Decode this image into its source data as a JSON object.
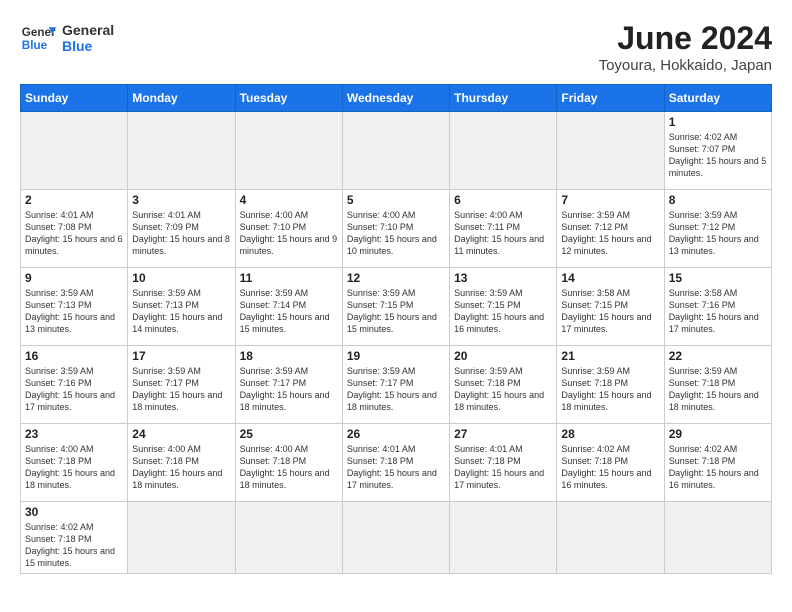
{
  "header": {
    "logo_general": "General",
    "logo_blue": "Blue",
    "title": "June 2024",
    "subtitle": "Toyoura, Hokkaido, Japan"
  },
  "days_of_week": [
    "Sunday",
    "Monday",
    "Tuesday",
    "Wednesday",
    "Thursday",
    "Friday",
    "Saturday"
  ],
  "weeks": [
    [
      {
        "day": "",
        "info": ""
      },
      {
        "day": "",
        "info": ""
      },
      {
        "day": "",
        "info": ""
      },
      {
        "day": "",
        "info": ""
      },
      {
        "day": "",
        "info": ""
      },
      {
        "day": "",
        "info": ""
      },
      {
        "day": "1",
        "info": "Sunrise: 4:02 AM\nSunset: 7:07 PM\nDaylight: 15 hours and 5 minutes."
      }
    ],
    [
      {
        "day": "2",
        "info": "Sunrise: 4:01 AM\nSunset: 7:08 PM\nDaylight: 15 hours and 6 minutes."
      },
      {
        "day": "3",
        "info": "Sunrise: 4:01 AM\nSunset: 7:09 PM\nDaylight: 15 hours and 8 minutes."
      },
      {
        "day": "4",
        "info": "Sunrise: 4:00 AM\nSunset: 7:10 PM\nDaylight: 15 hours and 9 minutes."
      },
      {
        "day": "5",
        "info": "Sunrise: 4:00 AM\nSunset: 7:10 PM\nDaylight: 15 hours and 10 minutes."
      },
      {
        "day": "6",
        "info": "Sunrise: 4:00 AM\nSunset: 7:11 PM\nDaylight: 15 hours and 11 minutes."
      },
      {
        "day": "7",
        "info": "Sunrise: 3:59 AM\nSunset: 7:12 PM\nDaylight: 15 hours and 12 minutes."
      },
      {
        "day": "8",
        "info": "Sunrise: 3:59 AM\nSunset: 7:12 PM\nDaylight: 15 hours and 13 minutes."
      }
    ],
    [
      {
        "day": "9",
        "info": "Sunrise: 3:59 AM\nSunset: 7:13 PM\nDaylight: 15 hours and 13 minutes."
      },
      {
        "day": "10",
        "info": "Sunrise: 3:59 AM\nSunset: 7:13 PM\nDaylight: 15 hours and 14 minutes."
      },
      {
        "day": "11",
        "info": "Sunrise: 3:59 AM\nSunset: 7:14 PM\nDaylight: 15 hours and 15 minutes."
      },
      {
        "day": "12",
        "info": "Sunrise: 3:59 AM\nSunset: 7:15 PM\nDaylight: 15 hours and 15 minutes."
      },
      {
        "day": "13",
        "info": "Sunrise: 3:59 AM\nSunset: 7:15 PM\nDaylight: 15 hours and 16 minutes."
      },
      {
        "day": "14",
        "info": "Sunrise: 3:58 AM\nSunset: 7:15 PM\nDaylight: 15 hours and 17 minutes."
      },
      {
        "day": "15",
        "info": "Sunrise: 3:58 AM\nSunset: 7:16 PM\nDaylight: 15 hours and 17 minutes."
      }
    ],
    [
      {
        "day": "16",
        "info": "Sunrise: 3:59 AM\nSunset: 7:16 PM\nDaylight: 15 hours and 17 minutes."
      },
      {
        "day": "17",
        "info": "Sunrise: 3:59 AM\nSunset: 7:17 PM\nDaylight: 15 hours and 18 minutes."
      },
      {
        "day": "18",
        "info": "Sunrise: 3:59 AM\nSunset: 7:17 PM\nDaylight: 15 hours and 18 minutes."
      },
      {
        "day": "19",
        "info": "Sunrise: 3:59 AM\nSunset: 7:17 PM\nDaylight: 15 hours and 18 minutes."
      },
      {
        "day": "20",
        "info": "Sunrise: 3:59 AM\nSunset: 7:18 PM\nDaylight: 15 hours and 18 minutes."
      },
      {
        "day": "21",
        "info": "Sunrise: 3:59 AM\nSunset: 7:18 PM\nDaylight: 15 hours and 18 minutes."
      },
      {
        "day": "22",
        "info": "Sunrise: 3:59 AM\nSunset: 7:18 PM\nDaylight: 15 hours and 18 minutes."
      }
    ],
    [
      {
        "day": "23",
        "info": "Sunrise: 4:00 AM\nSunset: 7:18 PM\nDaylight: 15 hours and 18 minutes."
      },
      {
        "day": "24",
        "info": "Sunrise: 4:00 AM\nSunset: 7:18 PM\nDaylight: 15 hours and 18 minutes."
      },
      {
        "day": "25",
        "info": "Sunrise: 4:00 AM\nSunset: 7:18 PM\nDaylight: 15 hours and 18 minutes."
      },
      {
        "day": "26",
        "info": "Sunrise: 4:01 AM\nSunset: 7:18 PM\nDaylight: 15 hours and 17 minutes."
      },
      {
        "day": "27",
        "info": "Sunrise: 4:01 AM\nSunset: 7:18 PM\nDaylight: 15 hours and 17 minutes."
      },
      {
        "day": "28",
        "info": "Sunrise: 4:02 AM\nSunset: 7:18 PM\nDaylight: 15 hours and 16 minutes."
      },
      {
        "day": "29",
        "info": "Sunrise: 4:02 AM\nSunset: 7:18 PM\nDaylight: 15 hours and 16 minutes."
      }
    ],
    [
      {
        "day": "30",
        "info": "Sunrise: 4:02 AM\nSunset: 7:18 PM\nDaylight: 15 hours and 15 minutes."
      },
      {
        "day": "",
        "info": ""
      },
      {
        "day": "",
        "info": ""
      },
      {
        "day": "",
        "info": ""
      },
      {
        "day": "",
        "info": ""
      },
      {
        "day": "",
        "info": ""
      },
      {
        "day": "",
        "info": ""
      }
    ]
  ]
}
